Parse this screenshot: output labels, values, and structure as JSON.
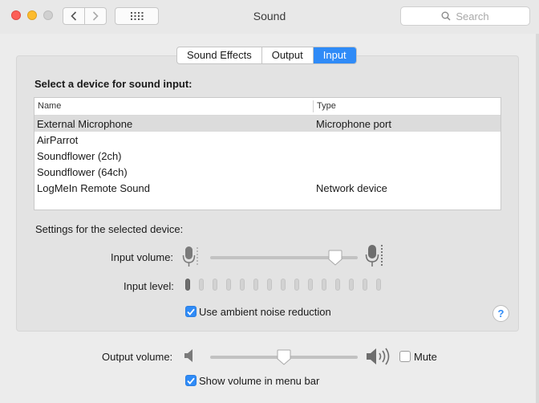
{
  "window": {
    "title": "Sound"
  },
  "search": {
    "placeholder": "Search"
  },
  "tabs": [
    {
      "label": "Sound Effects",
      "active": false
    },
    {
      "label": "Output",
      "active": false
    },
    {
      "label": "Input",
      "active": true
    }
  ],
  "input": {
    "heading": "Select a device for sound input:",
    "columns": {
      "name": "Name",
      "type": "Type"
    },
    "devices": [
      {
        "name": "External Microphone",
        "type": "Microphone port",
        "selected": true
      },
      {
        "name": "AirParrot",
        "type": ""
      },
      {
        "name": "Soundflower (2ch)",
        "type": ""
      },
      {
        "name": "Soundflower (64ch)",
        "type": ""
      },
      {
        "name": "LogMeIn Remote Sound",
        "type": "Network device"
      }
    ],
    "settings_label": "Settings for the selected device:",
    "volume_label": "Input volume:",
    "volume_level": 0.85,
    "level_label": "Input level:",
    "level_segments": 15,
    "level_active": 1,
    "ambient_label": "Use ambient noise reduction",
    "ambient_checked": true
  },
  "output": {
    "volume_label": "Output volume:",
    "volume_level": 0.5,
    "mute_label": "Mute",
    "mute_checked": false,
    "menubar_label": "Show volume in menu bar",
    "menubar_checked": true
  },
  "colors": {
    "accent": "#2f8bf7",
    "close": "#fc5f57",
    "minimize": "#fdbc2e"
  },
  "icons": [
    "chevron-left-icon",
    "chevron-right-icon",
    "grid-icon",
    "search-icon",
    "microphone-icon",
    "speaker-icon",
    "speaker-loud-icon",
    "checkmark-icon",
    "help-icon"
  ]
}
